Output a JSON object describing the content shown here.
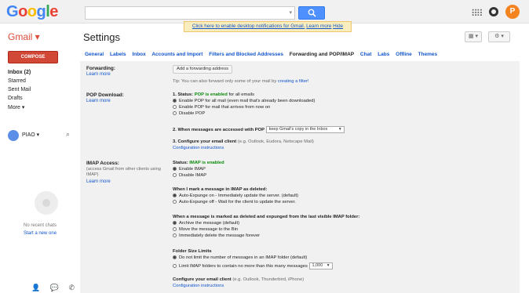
{
  "topbar": {
    "search_placeholder": "",
    "avatar_letter": "P"
  },
  "header": {
    "app_label": "Gmail ▾",
    "page_title": "Settings",
    "notice_text": "Click here to enable desktop notifications for Gmail.",
    "notice_learn": "Learn more",
    "notice_hide": "Hide",
    "toolbar_view": "▦ ▾",
    "toolbar_gear": "⚙ ▾"
  },
  "sidebar": {
    "compose": "COMPOSE",
    "items": [
      "Inbox (2)",
      "Starred",
      "Sent Mail",
      "Drafts",
      "More ▾"
    ],
    "user_name": "PIAO ▾",
    "no_chats": "No recent chats",
    "start_chat": "Start a new one"
  },
  "tabs": [
    "General",
    "Labels",
    "Inbox",
    "Accounts and Import",
    "Filters and Blocked Addresses",
    "Forwarding and POP/IMAP",
    "Chat",
    "Labs",
    "Offline",
    "Themes"
  ],
  "forwarding": {
    "label": "Forwarding:",
    "learn": "Learn more",
    "add_button": "Add a forwarding address",
    "tip": "Tip: You can also forward only some of your mail by",
    "tip_link": "creating a filter!"
  },
  "pop": {
    "label": "POP Download:",
    "learn": "Learn more",
    "status_prefix": "1. Status:",
    "status_value": "POP is enabled",
    "status_suffix": "for all emails",
    "opt1": "Enable POP for all mail (even mail that's already been downloaded)",
    "opt2": "Enable POP for mail that arrives from now on",
    "opt3": "Disable POP",
    "step2": "2. When messages are accessed with POP",
    "step2_select": "keep Gmail's copy in the Inbox",
    "step3": "3. Configure your email client",
    "step3_suffix": "(e.g. Outlook, Eudora, Netscape Mail)",
    "config_link": "Configuration instructions"
  },
  "imap": {
    "label": "IMAP Access:",
    "desc": "(access Gmail from other clients using IMAP)",
    "learn": "Learn more",
    "status_prefix": "Status:",
    "status_value": "IMAP is enabled",
    "enable": "Enable IMAP",
    "disable": "Disable IMAP",
    "deleted_title": "When I mark a message in IMAP as deleted:",
    "deleted_opt1": "Auto-Expunge on - Immediately update the server. (default)",
    "deleted_opt2": "Auto-Expunge off - Wait for the client to update the server.",
    "expunged_title": "When a message is marked as deleted and expunged from the last visible IMAP folder:",
    "expunged_opt1": "Archive the message (default)",
    "expunged_opt2": "Move the message to the Bin",
    "expunged_opt3": "Immediately delete the message forever",
    "folder_title": "Folder Size Limits",
    "folder_opt1": "Do not limit the number of messages in an IMAP folder (default)",
    "folder_opt2": "Limit IMAP folders to contain no more than this many messages",
    "folder_select": "1,000",
    "configure": "Configure your email client",
    "configure_suffix": "(e.g. Outlook, Thunderbird, iPhone)",
    "config_link": "Configuration instructions"
  }
}
